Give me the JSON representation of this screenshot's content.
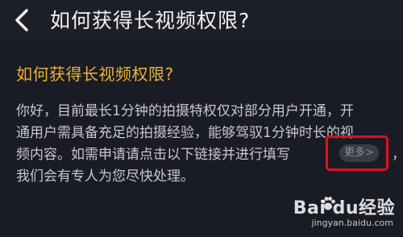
{
  "header": {
    "title": "如何获得长视频权限?",
    "back_icon": "chevron-left-icon"
  },
  "faq": {
    "title": "如何获得长视频权限?",
    "lines": [
      "你好，目前最长1分钟的拍摄特权仅对部分用户开通，开",
      "通用户需具备充足的拍摄经验，能够驾驭1分钟时长的视",
      "频内容。如需申请请点击以下链接并进行填写",
      "我们会有专人为您尽快处理。"
    ],
    "trailing_comma": "，",
    "more_button": "更多>"
  },
  "watermark": {
    "logo": "Bai du经验",
    "url": "jingyan.baidu.com"
  },
  "colors": {
    "title_accent": "#e9b437",
    "highlight_box": "#e0101e",
    "body_text": "#c8c8cc",
    "background": "#1a1c25"
  }
}
